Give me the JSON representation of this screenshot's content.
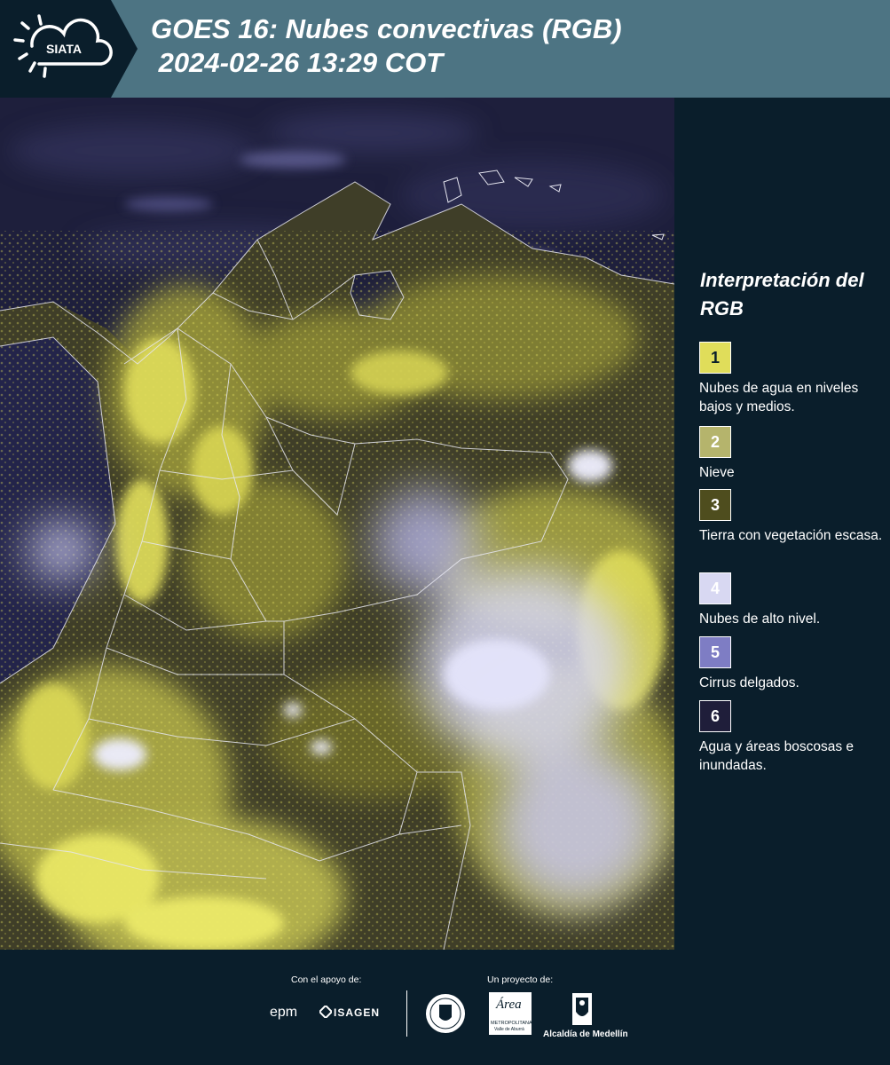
{
  "header": {
    "logo_text": "SIATA",
    "title_line1": "GOES 16: Nubes convectivas (RGB)",
    "title_line2": " 2024-02-26 13:29 COT"
  },
  "legend": {
    "title": "Interpretación del RGB",
    "items": [
      {
        "number": "1",
        "label": "Nubes de agua en niveles bajos y medios.",
        "color": "#e0dd5a",
        "text_color": "#0a1e2b"
      },
      {
        "number": "2",
        "label": "Nieve",
        "color": "#b5b46c",
        "text_color": "#ffffff"
      },
      {
        "number": "3",
        "label": "Tierra con vegetación escasa.",
        "color": "#4e4d1e",
        "text_color": "#ffffff"
      },
      {
        "number": "4",
        "label": "Nubes de alto nivel.",
        "color": "#d8d8f2",
        "text_color": "#ffffff"
      },
      {
        "number": "5",
        "label": "Cirrus delgados.",
        "color": "#7e7dc4",
        "text_color": "#ffffff"
      },
      {
        "number": "6",
        "label": "Agua y áreas boscosas e inundadas.",
        "color": "#1f1e3a",
        "text_color": "#ffffff"
      }
    ]
  },
  "footer": {
    "support_label": "Con el apoyo de:",
    "project_label": "Un proyecto de:",
    "sponsor_epm": "epm",
    "sponsor_isagen": "ISAGEN",
    "partner_area": "Área",
    "partner_area_sub1": "METROPOLITANA",
    "partner_area_sub2": "Valle de Aburrá",
    "partner_medellin": "Alcaldía de Medellín"
  },
  "colors": {
    "header_bg": "#4d7483",
    "panel_bg": "#0a1e2b",
    "map_water": "#1e1f3c",
    "cloud_yellow": "#e0dd5a",
    "high_cloud": "#d8d8f2"
  }
}
